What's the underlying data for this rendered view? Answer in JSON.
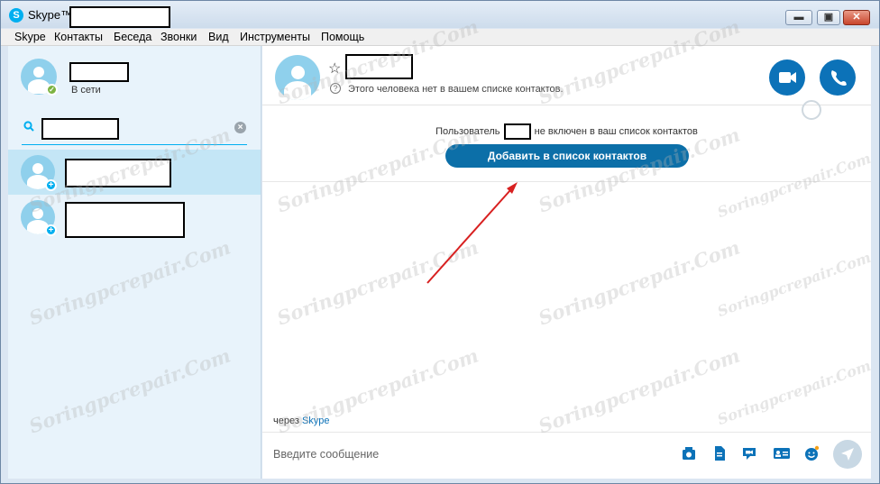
{
  "window": {
    "app_title": "Skype™ -",
    "app_logo": "S"
  },
  "menu": {
    "items": [
      "Skype",
      "Контакты",
      "Беседа",
      "Звонки",
      "Вид",
      "Инструменты",
      "Помощь"
    ]
  },
  "sidebar": {
    "profile": {
      "status": "В сети"
    },
    "search": {
      "placeholder": ""
    }
  },
  "chat": {
    "header_note": "Этого человека нет в вашем списке контактов.",
    "notice_prefix": "Пользователь",
    "notice_suffix": "не включен в ваш список контактов",
    "add_button": "Добавить в список контактов",
    "via_prefix": "через",
    "via_link": "Skype",
    "composer_placeholder": "Введите сообщение"
  },
  "watermark": {
    "text": "Soringpcrepair.Com"
  },
  "colors": {
    "accent": "#00aff0",
    "primary_button": "#0c6fa8",
    "call_button": "#0c72b8",
    "arrow": "#d82020"
  },
  "icons": [
    "skype-logo-icon",
    "minimize-icon",
    "maximize-icon",
    "close-icon",
    "search-icon",
    "clear-search-icon",
    "star-icon",
    "info-icon",
    "video-call-icon",
    "phone-call-icon",
    "globe-icon",
    "media-icon",
    "file-icon",
    "video-message-icon",
    "contact-card-icon",
    "emoticon-icon",
    "send-icon"
  ]
}
